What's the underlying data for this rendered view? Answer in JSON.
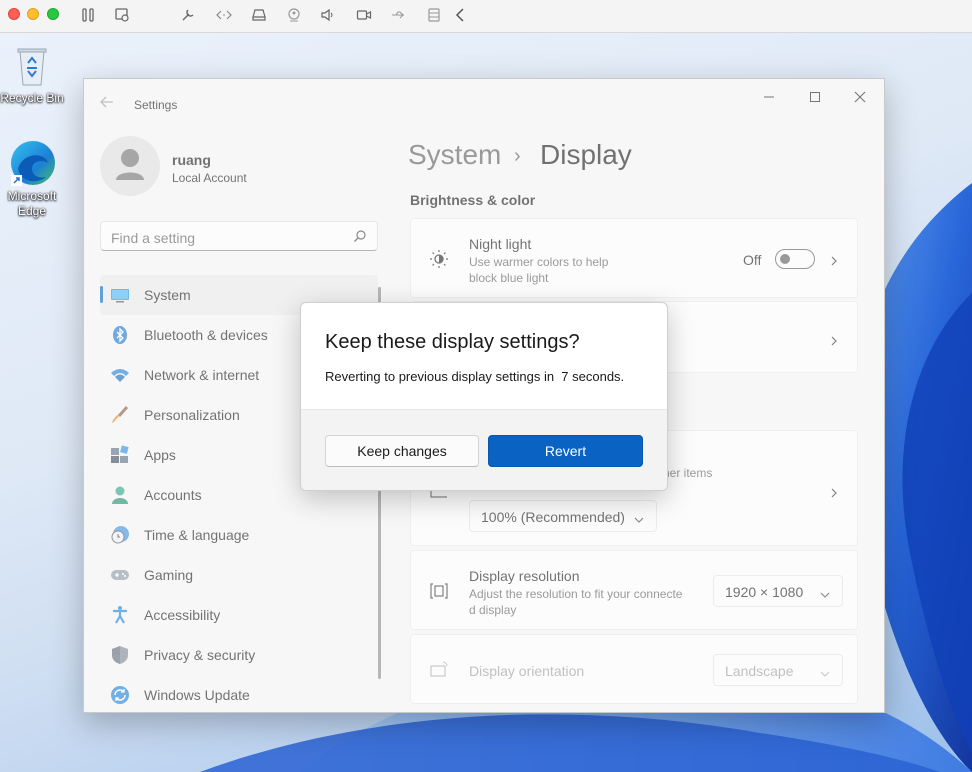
{
  "desktop": {
    "icons": [
      {
        "label": "Recycle Bin"
      },
      {
        "label": "Microsoft Edge"
      }
    ]
  },
  "settings": {
    "window_title": "Settings",
    "profile": {
      "name": "ruang",
      "account_type": "Local Account"
    },
    "search": {
      "placeholder": "Find a setting"
    },
    "nav": [
      {
        "label": "System",
        "icon": "system-icon",
        "selected": true
      },
      {
        "label": "Bluetooth & devices",
        "icon": "bluetooth-icon"
      },
      {
        "label": "Network & internet",
        "icon": "wifi-icon"
      },
      {
        "label": "Personalization",
        "icon": "brush-icon"
      },
      {
        "label": "Apps",
        "icon": "apps-icon"
      },
      {
        "label": "Accounts",
        "icon": "accounts-icon"
      },
      {
        "label": "Time & language",
        "icon": "clock-globe-icon"
      },
      {
        "label": "Gaming",
        "icon": "gamepad-icon"
      },
      {
        "label": "Accessibility",
        "icon": "accessibility-icon"
      },
      {
        "label": "Privacy & security",
        "icon": "shield-icon"
      },
      {
        "label": "Windows Update",
        "icon": "update-icon"
      }
    ],
    "breadcrumb": {
      "parent": "System",
      "separator": "›",
      "current": "Display"
    },
    "section_brightness": "Brightness & color",
    "night_light": {
      "title": "Night light",
      "desc_line1": "Use warmer colors to help",
      "desc_line2": "block blue light",
      "state": "Off"
    },
    "scale": {
      "partial_desc": "her items",
      "value": "100% (Recommended)"
    },
    "resolution": {
      "title": "Display resolution",
      "desc_line1": "Adjust the resolution to fit your connecte",
      "desc_line2": "d display",
      "value": "1920 × 1080"
    },
    "orientation": {
      "title": "Display orientation",
      "value": "Landscape"
    }
  },
  "dialog": {
    "title": "Keep these display settings?",
    "message": "Reverting to previous display settings in  7 seconds.",
    "keep_label": "Keep changes",
    "revert_label": "Revert"
  },
  "colors": {
    "accent": "#0a62c3",
    "nav_indicator": "#0067c0"
  }
}
